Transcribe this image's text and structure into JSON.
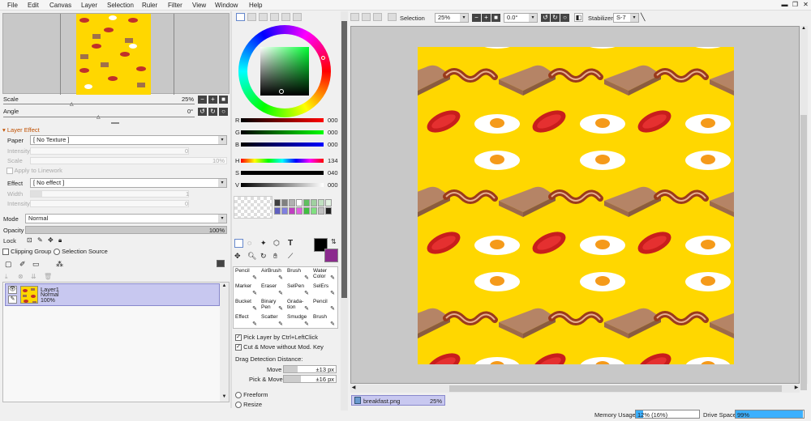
{
  "menu": [
    "File",
    "Edit",
    "Canvas",
    "Layer",
    "Selection",
    "Ruler",
    "Filter",
    "View",
    "Window",
    "Help"
  ],
  "navigator": {
    "scale_label": "Scale",
    "scale_value": "25%",
    "angle_label": "Angle",
    "angle_value": "0°"
  },
  "layer_effect": {
    "title": "Layer Effect",
    "paper_label": "Paper",
    "paper_value": "[ No Texture ]",
    "intensity_label": "Intensity",
    "intensity_value": "0",
    "scale_label": "Scale",
    "scale_value": "10%",
    "apply_label": "Apply to Linework",
    "effect_label": "Effect",
    "effect_value": "[ No effect ]",
    "width_label": "Width",
    "width_value": "1",
    "intensity2_label": "Intensity",
    "intensity2_value": "0"
  },
  "layer_panel": {
    "mode_label": "Mode",
    "mode_value": "Normal",
    "opacity_label": "Opacity",
    "opacity_value": "100%",
    "lock_label": "Lock",
    "clipping_label": "Clipping Group",
    "selection_source_label": "Selection Source",
    "layers": [
      {
        "name": "Layer1",
        "mode": "Normal",
        "opacity": "100%"
      }
    ]
  },
  "color": {
    "r_label": "R",
    "r_value": "000",
    "g_label": "G",
    "g_value": "000",
    "b_label": "B",
    "b_value": "000",
    "h_label": "H",
    "h_value": "134",
    "s_label": "S",
    "s_value": "040",
    "v_label": "V",
    "v_value": "000",
    "fg": "#000000",
    "bg": "#8b2a8e"
  },
  "swatches": [
    "#404040",
    "#808080",
    "#b0b0b0",
    "#ffffff",
    "#60c060",
    "#a0d0a0",
    "#c0e0c0",
    "#e0f0e0",
    "#6060c0",
    "#8080e0",
    "#c040c0",
    "#e060e0",
    "#40c040",
    "#80e080",
    "#c0c0c0",
    "#202020"
  ],
  "tools": [
    {
      "label": "Pencil"
    },
    {
      "label": "AirBrush"
    },
    {
      "label": "Brush"
    },
    {
      "label": "Water\nColor"
    },
    {
      "label": "Marker"
    },
    {
      "label": "Eraser"
    },
    {
      "label": "SelPen"
    },
    {
      "label": "SelErs"
    },
    {
      "label": "Bucket"
    },
    {
      "label": "Binary\nPen"
    },
    {
      "label": "Grada-\ntion"
    },
    {
      "label": "Pencil"
    },
    {
      "label": "Effect"
    },
    {
      "label": "Scatter"
    },
    {
      "label": "Smudge"
    },
    {
      "label": "Brush"
    }
  ],
  "tool_options": {
    "pick_layer": "Pick Layer by Ctrl+LeftClick",
    "cut_move": "Cut & Move without Mod. Key",
    "drag_detect": "Drag Detection Distance:",
    "move_label": "Move",
    "move_value": "±13 px",
    "pickmove_label": "Pick & Move",
    "pickmove_value": "±16 px",
    "freeform": "Freeform",
    "resize": "Resize"
  },
  "toolbar": {
    "selection_label": "Selection",
    "zoom_value": "25%",
    "angle_value": "0.0°",
    "stabilizer_label": "Stabilizer",
    "stabilizer_value": "S-7"
  },
  "canvas": {
    "background": "#ffd700"
  },
  "document": {
    "name": "breakfast.png",
    "zoom": "25%"
  },
  "status": {
    "memory_label": "Memory Usage",
    "memory_value": "12% (16%)",
    "memory_fraction": 0.12,
    "drive_label": "Drive Space",
    "drive_value": "99%",
    "drive_fraction": 0.99
  }
}
